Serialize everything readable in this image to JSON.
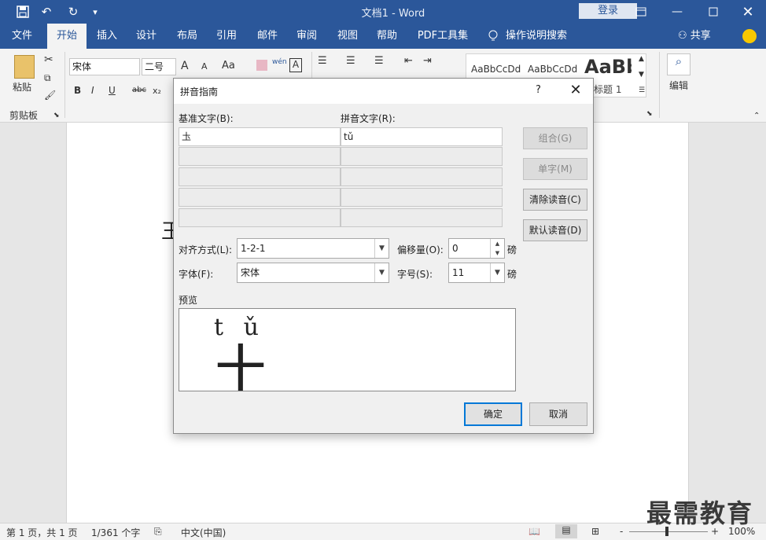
{
  "window": {
    "title": "文档1  -  Word",
    "login_label": "登录",
    "save_icon": "save-icon",
    "undo_icon": "undo-icon",
    "redo_icon": "redo-icon"
  },
  "ribbon_tabs": [
    "文件",
    "开始",
    "插入",
    "设计",
    "布局",
    "引用",
    "邮件",
    "审阅",
    "视图",
    "帮助",
    "PDF工具集",
    "操作说明搜索"
  ],
  "active_tab": "开始",
  "share_label": "共享",
  "ribbon": {
    "paste_label": "粘贴",
    "clipboard_label": "剪贴板",
    "font_name": "宋体",
    "font_size": "二号",
    "bold": "B",
    "italic": "I",
    "underline": "U",
    "strike": "abc",
    "subscript": "x₂",
    "grow": "A",
    "shrink": "A",
    "case": "Aa",
    "phonetic": "wén",
    "border": "A",
    "style_normal": "AaBbCcDd",
    "style_nospace": "AaBbCcDd",
    "style_h1": "AaBb",
    "style_h1_label": "标题 1",
    "edit_label": "编辑"
  },
  "document": {
    "visible_char": "王"
  },
  "dialog": {
    "title": "拼音指南",
    "help": "?",
    "base_text_label": "基准文字(B):",
    "ruby_text_label": "拼音文字(R):",
    "rows": [
      {
        "base": "圡",
        "ruby": "tǔ"
      },
      {
        "base": "",
        "ruby": ""
      },
      {
        "base": "",
        "ruby": ""
      },
      {
        "base": "",
        "ruby": ""
      },
      {
        "base": "",
        "ruby": ""
      }
    ],
    "group_btn": "组合(G)",
    "mono_btn": "单字(M)",
    "clear_btn": "清除读音(C)",
    "default_btn": "默认读音(D)",
    "alignment_label": "对齐方式(L):",
    "alignment_value": "1-2-1",
    "offset_label": "偏移量(O):",
    "offset_value": "0",
    "font_label": "字体(F):",
    "font_value": "宋体",
    "size_label": "字号(S):",
    "size_value": "11",
    "unit": "磅",
    "preview_label": "预览",
    "preview_ruby": "t ǔ",
    "preview_base": "土",
    "ok": "确定",
    "cancel": "取消"
  },
  "status": {
    "page": "第 1 页，共 1 页",
    "words": "1/361 个字",
    "language": "中文(中国)",
    "zoom": "100%",
    "minus": "-",
    "plus": "+"
  },
  "watermark": "最需教育"
}
